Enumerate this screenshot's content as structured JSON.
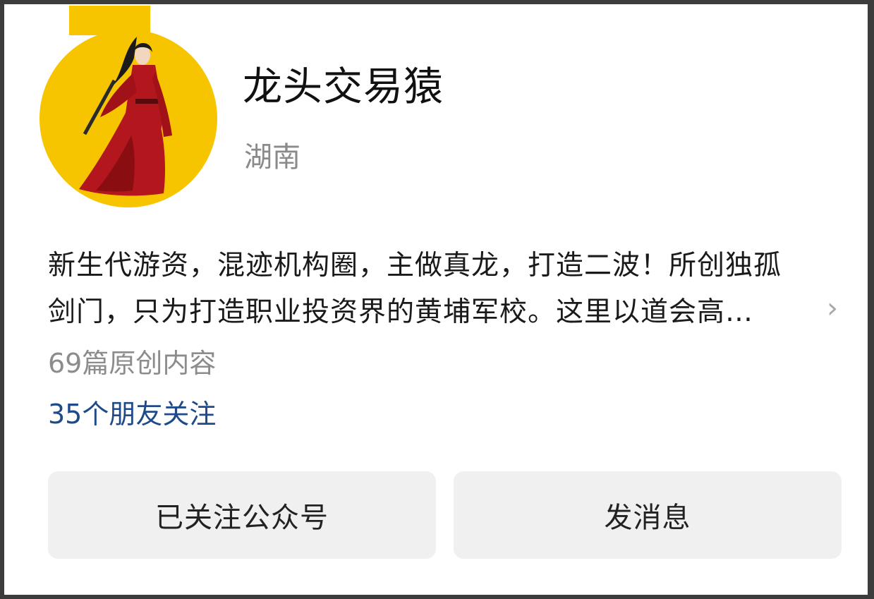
{
  "profile": {
    "name": "龙头交易猿",
    "location": "湖南",
    "bio_line1": "新生代游资，混迹机构圈，主做真龙，打造二波！所创独孤",
    "bio_line2": "剑门，只为打造职业投资界的黄埔军校。这里以道会高…",
    "articles": "69篇原创内容",
    "friends_following": "35个朋友关注"
  },
  "actions": {
    "follow_label": "已关注公众号",
    "message_label": "发消息"
  },
  "icons": {
    "expand": "chevron-right-icon"
  },
  "colors": {
    "avatar_bg": "#f7c400",
    "link": "#1f4a8a"
  }
}
